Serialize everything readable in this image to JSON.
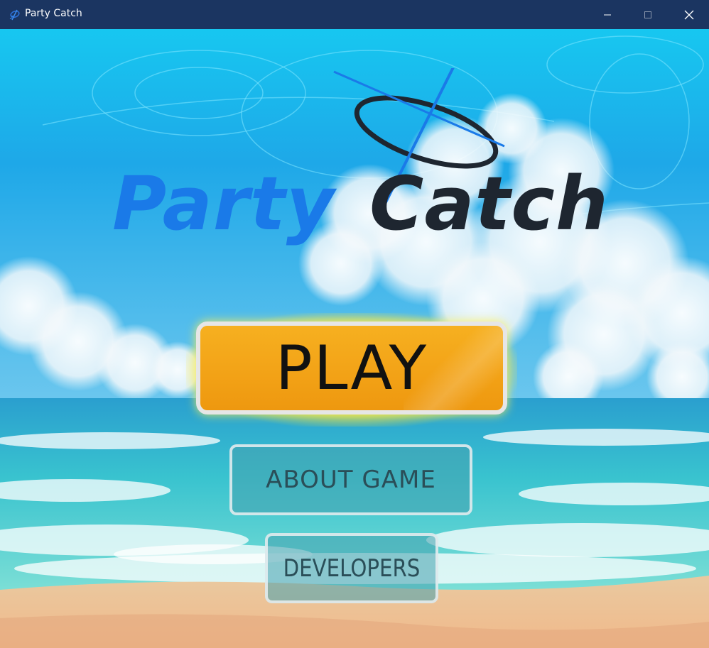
{
  "window": {
    "title": "Party Catch",
    "controls": {
      "minimize_icon": "minimize-icon",
      "maximize_icon": "maximize-icon",
      "close_icon": "close-icon"
    }
  },
  "logo": {
    "word_1": "Party",
    "word_2": "Catch"
  },
  "menu": {
    "play_label": "PLAY",
    "about_label": "ABOUT GAME",
    "developers_label": "DEVELOPERS"
  },
  "colors": {
    "titlebar": "#1b3561",
    "play_button": "#f3a418",
    "logo_blue": "#1a7ae8",
    "logo_dark": "#1e2630"
  }
}
